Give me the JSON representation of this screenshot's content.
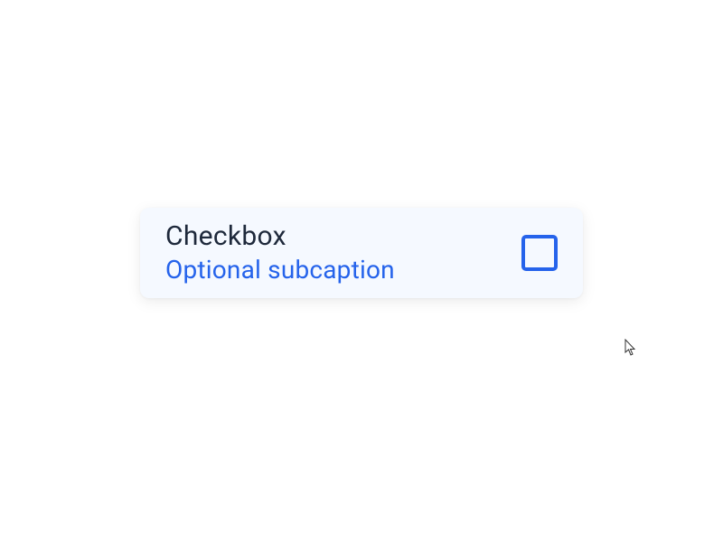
{
  "checkbox": {
    "title": "Checkbox",
    "subcaption": "Optional subcaption",
    "checked": false
  }
}
